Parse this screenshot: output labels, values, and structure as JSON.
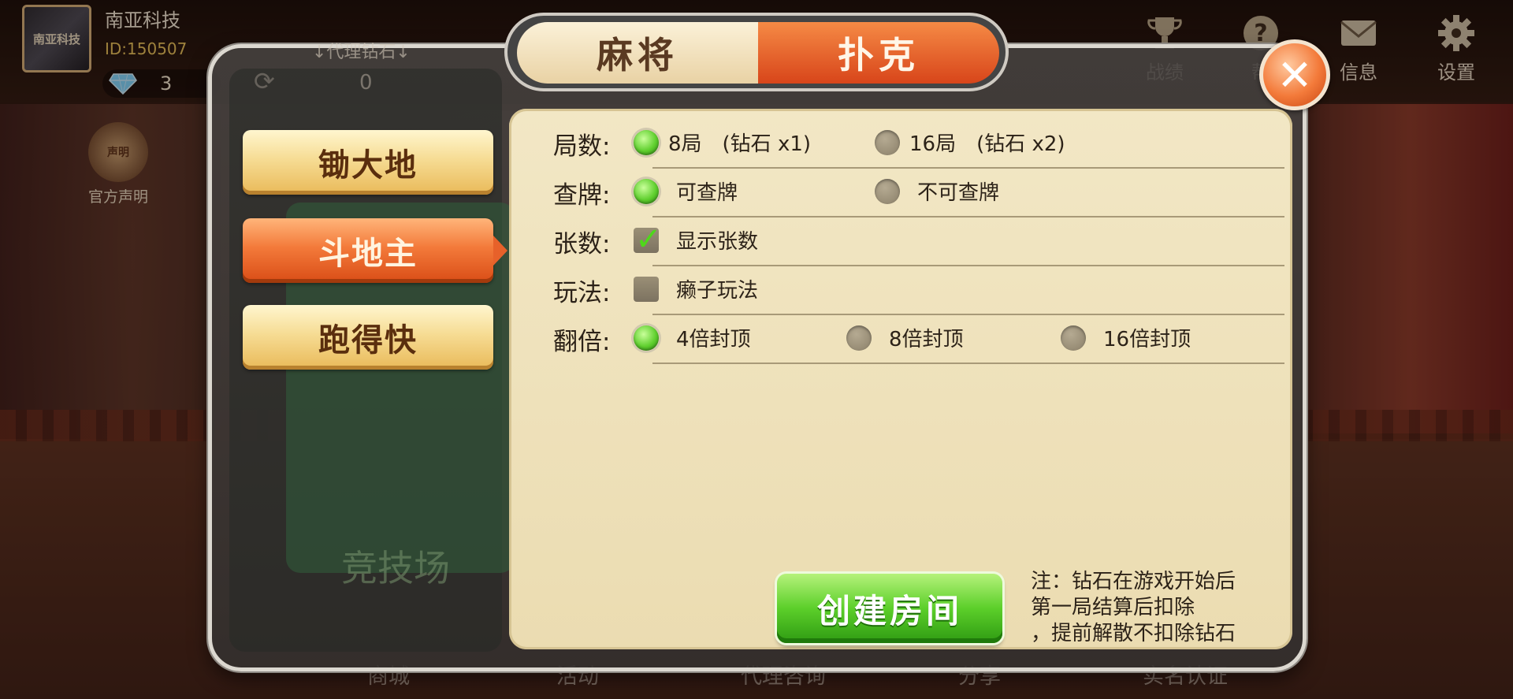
{
  "user": {
    "name": "南亚科技",
    "id": "ID:150507",
    "diamonds": "3",
    "avatar_text": "南亚科技"
  },
  "top_icons": [
    {
      "name": "trophy-icon",
      "label": "战绩"
    },
    {
      "name": "help-icon",
      "label": "帮"
    },
    {
      "name": "mail-icon",
      "label": "信息"
    },
    {
      "name": "gear-icon",
      "label": "设置"
    }
  ],
  "declaration": {
    "label": "官方声明",
    "scroll_text": "声明"
  },
  "background": {
    "agent_label": "↓代理钻石↓",
    "faint_count": "0",
    "left_panel_text": "竞技场"
  },
  "bottom_nav": [
    {
      "label": "商城"
    },
    {
      "label": "活动"
    },
    {
      "label": "代理咨询"
    },
    {
      "label": "分享"
    },
    {
      "label": "实名认证"
    }
  ],
  "tabs": {
    "mahjong": "麻将",
    "poker": "扑克",
    "active": "poker"
  },
  "games": [
    {
      "label": "锄大地",
      "active": false
    },
    {
      "label": "斗地主",
      "active": true
    },
    {
      "label": "跑得快",
      "active": false
    }
  ],
  "settings": {
    "rounds": {
      "label": "局数:",
      "options": [
        "8局　(钻石 x1)",
        "16局　(钻石 x2)"
      ],
      "selected": 0
    },
    "peek": {
      "label": "查牌:",
      "options": [
        "可查牌",
        "不可查牌"
      ],
      "selected": 0
    },
    "count": {
      "label": "张数:",
      "option": "显示张数",
      "checked": true
    },
    "mode": {
      "label": "玩法:",
      "option": "癞子玩法",
      "checked": false
    },
    "multiplier": {
      "label": "翻倍:",
      "options": [
        "4倍封顶",
        "8倍封顶",
        "16倍封顶"
      ],
      "selected": 0
    }
  },
  "create_button": "创建房间",
  "note": [
    "注：钻石在游戏开始后",
    "第一局结算后扣除",
    "，提前解散不扣除钻石"
  ],
  "colors": {
    "accent_orange": "#e7612a",
    "accent_green": "#5ccf2a",
    "panel_bg": "#f2e7c5"
  }
}
